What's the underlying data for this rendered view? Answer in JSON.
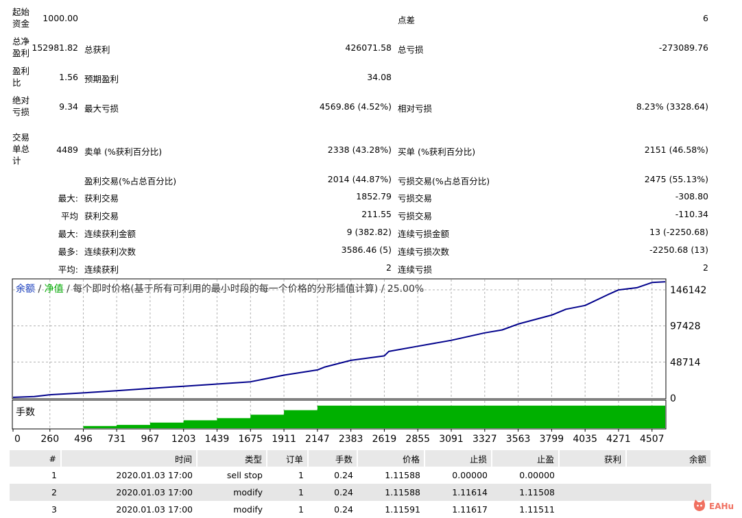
{
  "summary": {
    "initial_deposit_label": "起始资金",
    "initial_deposit_value": "1000.00",
    "spread_label": "点差",
    "spread_value": "6",
    "net_profit_label": "总净盈利",
    "net_profit_value": "152981.82",
    "gross_profit_label": "总获利",
    "gross_profit_value": "426071.58",
    "gross_loss_label": "总亏损",
    "gross_loss_value": "-273089.76",
    "profit_factor_label": "盈利比",
    "profit_factor_value": "1.56",
    "expected_payoff_label": "预期盈利",
    "expected_payoff_value": "34.08",
    "abs_drawdown_label": "绝对亏损",
    "abs_drawdown_value": "9.34",
    "max_drawdown_label": "最大亏损",
    "max_drawdown_value": "4569.86 (4.52%)",
    "rel_drawdown_label": "相对亏损",
    "rel_drawdown_value": "8.23% (3328.64)",
    "total_trades_label": "交易单总计",
    "total_trades_value": "4489",
    "short_label": "卖单 (%获利百分比)",
    "short_value": "2338 (43.28%)",
    "long_label": "买单 (%获利百分比)",
    "long_value": "2151 (46.58%)",
    "profit_trades_label": "盈利交易(%占总百分比)",
    "profit_trades_value": "2014 (44.87%)",
    "loss_trades_label": "亏损交易(%占总百分比)",
    "loss_trades_value": "2475 (55.13%)",
    "largest_prefix": "最大:",
    "largest_profit_label": "获利交易",
    "largest_profit_value": "1852.79",
    "largest_loss_label": "亏损交易",
    "largest_loss_value": "-308.80",
    "average_prefix": "平均",
    "average_profit_label": "获利交易",
    "average_profit_value": "211.55",
    "average_loss_label": "亏损交易",
    "average_loss_value": "-110.34",
    "max_cons_prefix": "最大:",
    "max_cons_wins_label": "连续获利金额",
    "max_cons_wins_value": "9 (382.82)",
    "max_cons_losses_label": "连续亏损金额",
    "max_cons_losses_value": "13 (-2250.68)",
    "maximal_prefix": "最多:",
    "maximal_cons_profit_label": "连续获利次数",
    "maximal_cons_profit_value": "3586.46 (5)",
    "maximal_cons_loss_label": "连续亏损次数",
    "maximal_cons_loss_value": "-2250.68 (13)",
    "avg_cons_prefix": "平均:",
    "avg_cons_wins_label": "连续获利",
    "avg_cons_wins_value": "2",
    "avg_cons_losses_label": "连续亏损",
    "avg_cons_losses_value": "2"
  },
  "chart_data": {
    "type": "line",
    "title_parts": {
      "balance": "余额",
      "sep1": " / ",
      "equity": "净值",
      "rest": " / 每个即时价格(基于所有可利用的最小时段的每一个价格的分形插值计算) / 25.00%"
    },
    "y_ticks": [
      "146142",
      "97428",
      "48714",
      "0"
    ],
    "ylim": [
      0,
      160000
    ],
    "x_ticks": [
      "0",
      "260",
      "496",
      "731",
      "967",
      "1203",
      "1439",
      "1675",
      "1911",
      "2147",
      "2383",
      "2619",
      "2855",
      "3091",
      "3327",
      "3563",
      "3799",
      "4035",
      "4271",
      "4507"
    ],
    "xlim": [
      0,
      4600
    ],
    "series": [
      {
        "name": "余额",
        "color": "#00008b",
        "x": [
          0,
          150,
          260,
          496,
          731,
          967,
          1203,
          1439,
          1675,
          1911,
          2147,
          2200,
          2383,
          2619,
          2650,
          2855,
          3091,
          3327,
          3450,
          3563,
          3799,
          3900,
          4035,
          4200,
          4271,
          4400,
          4507,
          4600
        ],
        "values": [
          1000,
          2000,
          4500,
          7000,
          10000,
          13000,
          16000,
          19000,
          22000,
          31000,
          38000,
          42000,
          51000,
          57000,
          63000,
          70000,
          78000,
          88000,
          92000,
          100000,
          112000,
          120000,
          125000,
          140000,
          146000,
          149000,
          156000,
          157000
        ]
      }
    ],
    "volume_panel": {
      "label": "手数",
      "color": "#00b000",
      "x": [
        0,
        496,
        731,
        967,
        1203,
        1439,
        1675,
        1911,
        2147,
        2383,
        4600
      ],
      "values": [
        0.0,
        0.1,
        0.15,
        0.25,
        0.35,
        0.45,
        0.6,
        0.8,
        1.0,
        1.0,
        1.0
      ]
    },
    "grid": true
  },
  "table": {
    "headers": [
      "#",
      "时间",
      "类型",
      "订单",
      "手数",
      "价格",
      "止损",
      "止盈",
      "获利",
      "余额"
    ],
    "rows": [
      [
        "1",
        "2020.01.03 17:00",
        "sell stop",
        "1",
        "0.24",
        "1.11588",
        "0.00000",
        "0.00000",
        "",
        ""
      ],
      [
        "2",
        "2020.01.03 17:00",
        "modify",
        "1",
        "0.24",
        "1.11588",
        "1.11614",
        "1.11508",
        "",
        ""
      ],
      [
        "3",
        "2020.01.03 17:00",
        "modify",
        "1",
        "0.24",
        "1.11591",
        "1.11617",
        "1.11511",
        "",
        ""
      ]
    ]
  },
  "watermark": {
    "text": "EAHub",
    "color": "#f07060"
  }
}
